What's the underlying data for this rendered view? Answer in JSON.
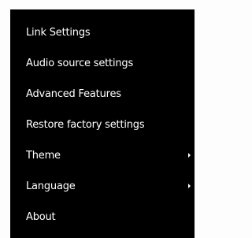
{
  "menu": {
    "items": [
      {
        "label": "Link Settings",
        "has_submenu": false
      },
      {
        "label": "Audio source settings",
        "has_submenu": false
      },
      {
        "label": "Advanced Features",
        "has_submenu": false
      },
      {
        "label": "Restore factory settings",
        "has_submenu": false
      },
      {
        "label": "Theme",
        "has_submenu": true
      },
      {
        "label": "Language",
        "has_submenu": true
      },
      {
        "label": "About",
        "has_submenu": false
      }
    ]
  }
}
